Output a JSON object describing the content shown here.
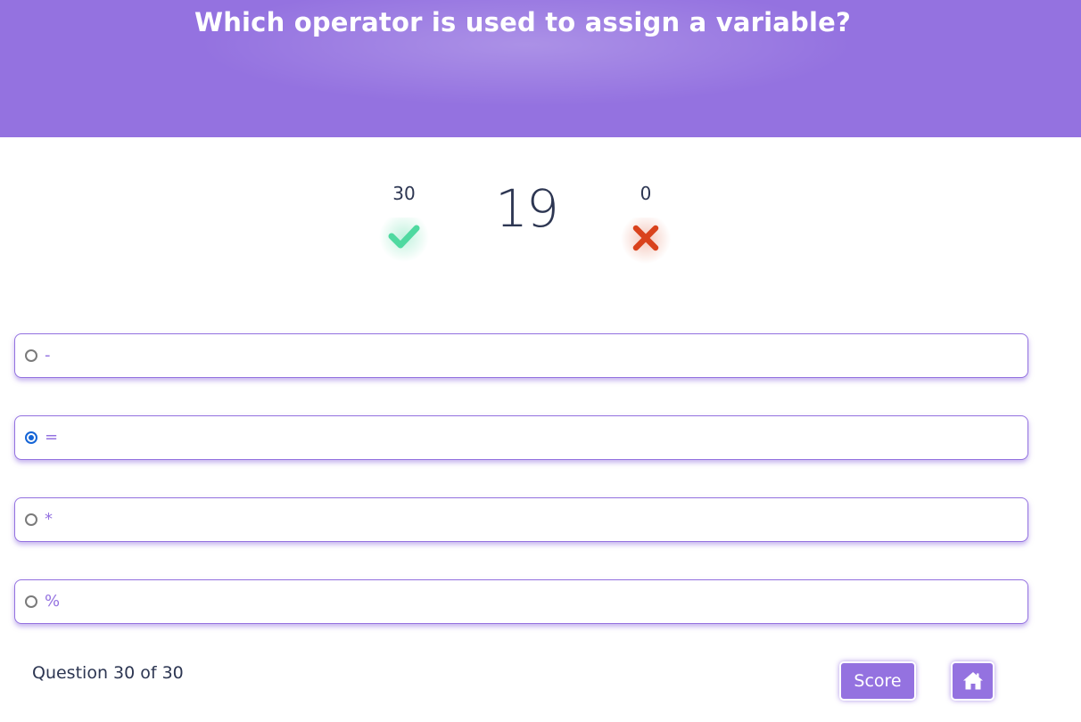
{
  "quiz": {
    "question": "Which operator is used to assign a variable?",
    "correct_count": "30",
    "wrong_count": "0",
    "timer": "19",
    "selected_option_index": 1,
    "options": [
      {
        "label": "-",
        "selected": false
      },
      {
        "label": "=",
        "selected": true
      },
      {
        "label": "*",
        "selected": false
      },
      {
        "label": "%",
        "selected": false
      }
    ],
    "progress_text": "Question 30 of 30"
  },
  "actions": {
    "score_label": "Score",
    "home_icon": "home-icon"
  },
  "colors": {
    "accent": "#9472e0",
    "text": "#2d3652",
    "correct": "#4fd9a0",
    "wrong": "#d9421c",
    "radio_selected": "#1565d6"
  },
  "icons": {
    "correct": "check-icon",
    "wrong": "cross-icon"
  }
}
